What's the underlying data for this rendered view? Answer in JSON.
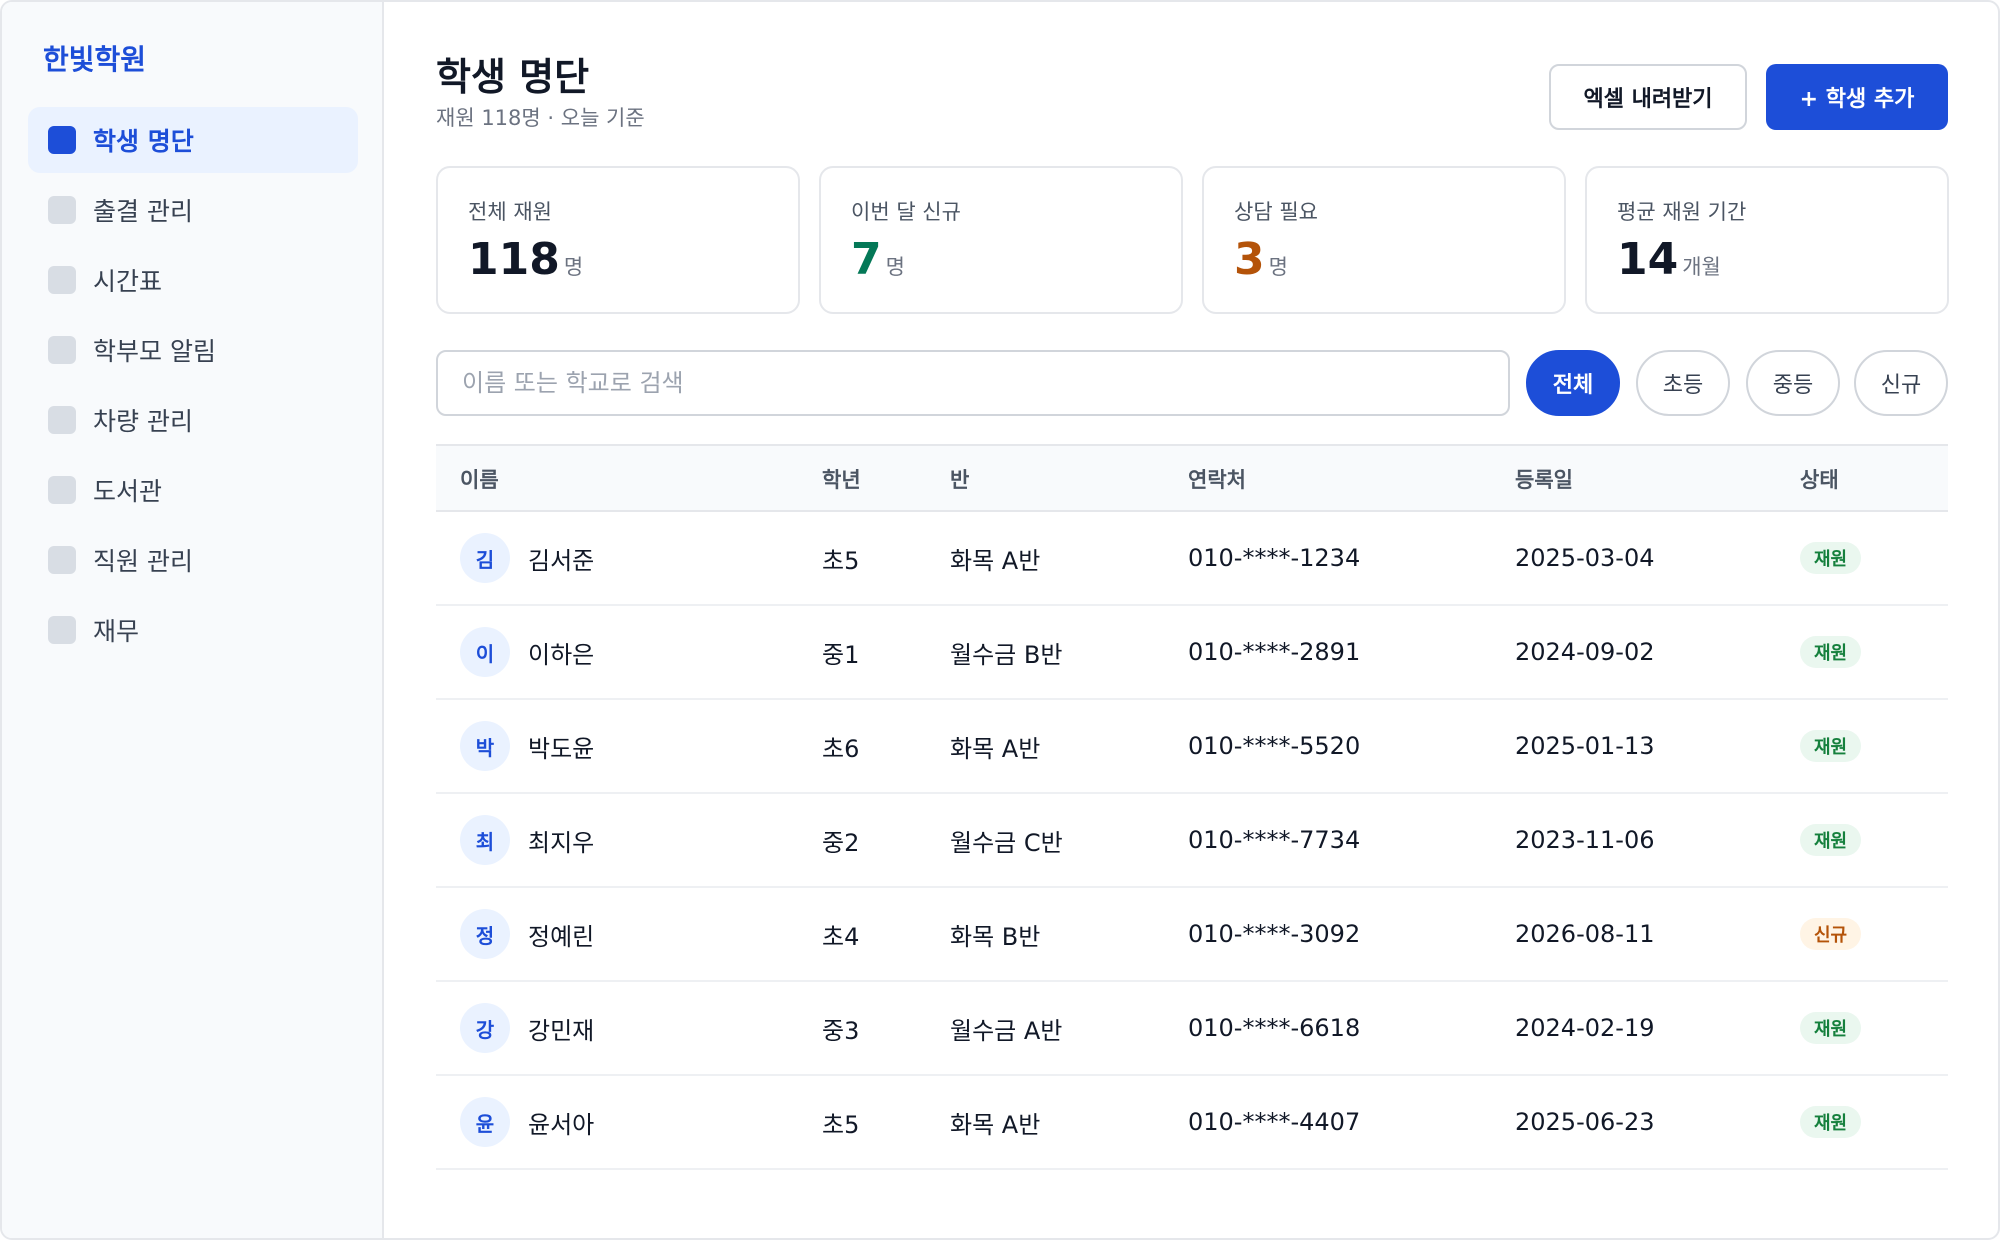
{
  "sidebar": {
    "brand": "한빛학원",
    "items": [
      {
        "label": "학생 명단",
        "active": true
      },
      {
        "label": "출결 관리"
      },
      {
        "label": "시간표"
      },
      {
        "label": "학부모 알림"
      },
      {
        "label": "차량 관리"
      },
      {
        "label": "도서관"
      },
      {
        "label": "직원 관리"
      },
      {
        "label": "재무"
      }
    ]
  },
  "header": {
    "title": "학생 명단",
    "subtitle": "재원 118명 · 오늘 기준",
    "export_label": "엑셀 내려받기",
    "add_label": "+ 학생 추가"
  },
  "stats": [
    {
      "label": "전체 재원",
      "value": "118",
      "unit": "명",
      "color": "#111827"
    },
    {
      "label": "이번 달 신규",
      "value": "7",
      "unit": "명",
      "color": "#047857"
    },
    {
      "label": "상담 필요",
      "value": "3",
      "unit": "명",
      "color": "#b45309"
    },
    {
      "label": "평균 재원 기간",
      "value": "14",
      "unit": "개월",
      "color": "#111827"
    }
  ],
  "search": {
    "placeholder": "이름 또는 학교로 검색",
    "value": ""
  },
  "filters": [
    {
      "label": "전체",
      "active": true
    },
    {
      "label": "초등"
    },
    {
      "label": "중등"
    },
    {
      "label": "신규"
    }
  ],
  "table": {
    "headers": [
      "이름",
      "학년",
      "반",
      "연락처",
      "등록일",
      "상태"
    ],
    "rows": [
      {
        "initial": "김",
        "name": "김서준",
        "grade": "초5",
        "class": "화목 A반",
        "phone": "010-****-1234",
        "date": "2025-03-04",
        "status": "재원",
        "status_type": "ok"
      },
      {
        "initial": "이",
        "name": "이하은",
        "grade": "중1",
        "class": "월수금 B반",
        "phone": "010-****-2891",
        "date": "2024-09-02",
        "status": "재원",
        "status_type": "ok"
      },
      {
        "initial": "박",
        "name": "박도윤",
        "grade": "초6",
        "class": "화목 A반",
        "phone": "010-****-5520",
        "date": "2025-01-13",
        "status": "재원",
        "status_type": "ok"
      },
      {
        "initial": "최",
        "name": "최지우",
        "grade": "중2",
        "class": "월수금 C반",
        "phone": "010-****-7734",
        "date": "2023-11-06",
        "status": "재원",
        "status_type": "ok"
      },
      {
        "initial": "정",
        "name": "정예린",
        "grade": "초4",
        "class": "화목 B반",
        "phone": "010-****-3092",
        "date": "2026-08-11",
        "status": "신규",
        "status_type": "new"
      },
      {
        "initial": "강",
        "name": "강민재",
        "grade": "중3",
        "class": "월수금 A반",
        "phone": "010-****-6618",
        "date": "2024-02-19",
        "status": "재원",
        "status_type": "ok"
      },
      {
        "initial": "윤",
        "name": "윤서아",
        "grade": "초5",
        "class": "화목 A반",
        "phone": "010-****-4407",
        "date": "2025-06-23",
        "status": "재원",
        "status_type": "ok"
      }
    ]
  }
}
